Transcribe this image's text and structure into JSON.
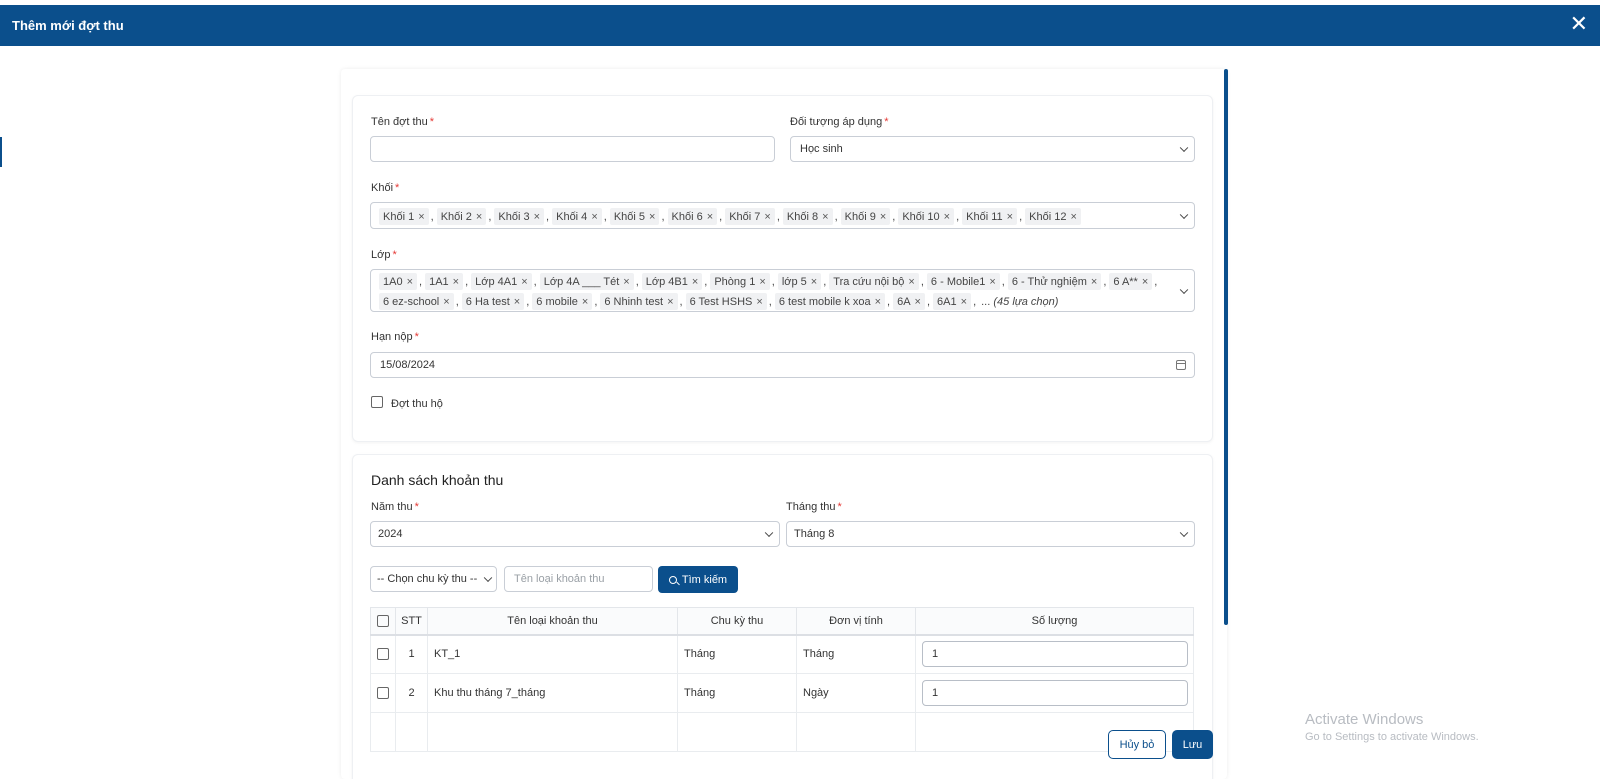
{
  "dialog": {
    "title": "Thêm mới đợt thu",
    "close_glyph": "✕"
  },
  "form": {
    "name": {
      "label": "Tên đợt thu",
      "value": ""
    },
    "target": {
      "label": "Đối tượng áp dụng",
      "value": "Học sinh"
    },
    "grade": {
      "label": "Khối",
      "tags": [
        "Khối 1",
        "Khối 2",
        "Khối 3",
        "Khối 4",
        "Khối 5",
        "Khối 6",
        "Khối 7",
        "Khối 8",
        "Khối 9",
        "Khối 10",
        "Khối 11",
        "Khối 12"
      ]
    },
    "class": {
      "label": "Lớp",
      "tags": [
        "1A0",
        "1A1",
        "Lớp 4A1",
        "Lớp 4A ___ Tét",
        "Lớp 4B1",
        "Phòng 1",
        "lớp 5",
        "Tra cứu nội bộ",
        "6 - Mobile1",
        "6 - Thử nghiệm",
        "6 A**",
        "6 ez-school",
        "6 Ha test",
        "6 mobile",
        "6 Nhinh test",
        "6 Test HSHS",
        "6 test mobile k xoa",
        "6A",
        "6A1"
      ],
      "more_prefix": "... ",
      "more_text": "(45 lựa chọn)"
    },
    "deadline": {
      "label": "Hạn nộp",
      "value": "15/08/2024"
    },
    "collect_on_behalf": {
      "label": "Đợt thu hộ",
      "checked": false
    }
  },
  "fees": {
    "title": "Danh sách khoản thu",
    "year": {
      "label": "Năm thu",
      "value": "2024"
    },
    "month": {
      "label": "Tháng thu",
      "value": "Tháng 8"
    },
    "cycle_filter": {
      "value": "-- Chọn chu kỳ thu --"
    },
    "search": {
      "placeholder": "Tên loại khoản thu",
      "button_label": "Tìm kiếm"
    },
    "table": {
      "headers": [
        "STT",
        "Tên loại khoản thu",
        "Chu kỳ thu",
        "Đơn vị tính",
        "Số lượng"
      ],
      "rows": [
        {
          "stt": "1",
          "name": "KT_1",
          "cycle": "Tháng",
          "unit": "Tháng",
          "qty": "1"
        },
        {
          "stt": "2",
          "name": "Khu thu tháng 7_tháng",
          "cycle": "Tháng",
          "unit": "Ngày",
          "qty": "1"
        }
      ]
    }
  },
  "actions": {
    "cancel_label": "Hủy bỏ",
    "save_label": "Lưu"
  },
  "watermark": {
    "line1": "Activate Windows",
    "line2": "Go to Settings to activate Windows."
  },
  "required_mark": "*",
  "colors": {
    "primary": "#0b4f8c",
    "required": "#e53935"
  }
}
